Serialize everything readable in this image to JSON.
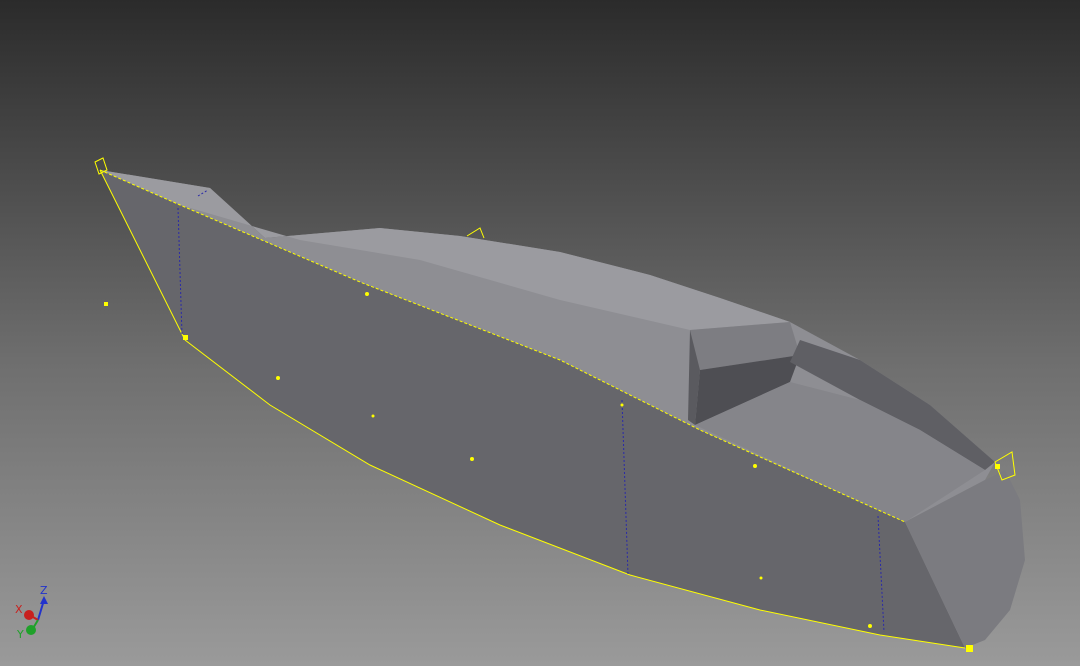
{
  "viewport": {
    "background_top": "#2b2b2b",
    "background_bottom": "#9a9a9a",
    "model_color": "#707075",
    "sketch_color": "#ffff00",
    "section_line_color": "#2a2aa8"
  },
  "view_cube": {
    "x_label": "X",
    "y_label": "Y",
    "z_label": "Z",
    "x_color": "#c8201e",
    "y_color": "#1fa12a",
    "z_color": "#2233cc"
  }
}
